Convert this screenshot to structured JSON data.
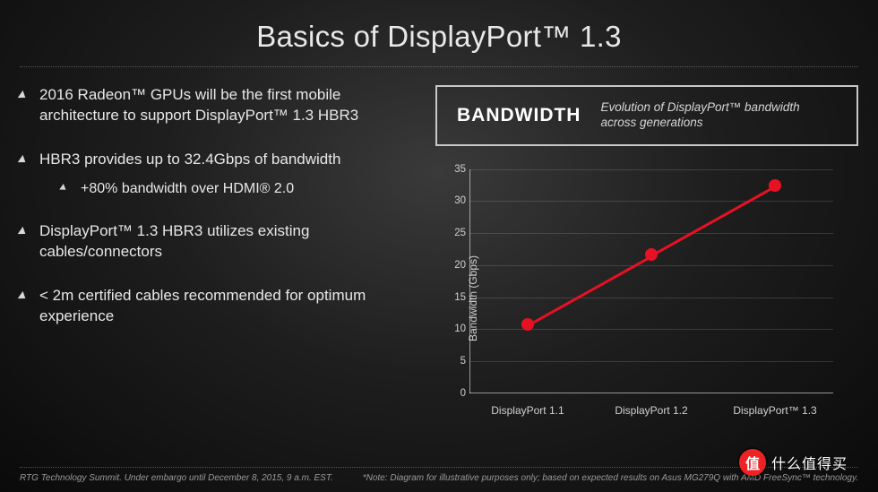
{
  "title": "Basics of DisplayPort™ 1.3",
  "bullets": [
    {
      "text": "2016 Radeon™ GPUs will be the first mobile architecture to support DisplayPort™ 1.3 HBR3"
    },
    {
      "text": "HBR3 provides up to 32.4Gbps of bandwidth",
      "sub": [
        "+80% bandwidth over HDMI® 2.0"
      ]
    },
    {
      "text": "DisplayPort™ 1.3 HBR3 utilizes existing cables/connectors"
    },
    {
      "text": "< 2m certified cables recommended for optimum experience"
    }
  ],
  "box": {
    "title": "BANDWIDTH",
    "subtitle": "Evolution of DisplayPort™ bandwidth across generations"
  },
  "footer": {
    "left": "RTG Technology Summit. Under embargo until December 8, 2015, 9 a.m. EST.",
    "right": "*Note: Diagram for illustrative purposes only; based on expected results on Asus MG279Q with AMD FreeSync™ technology."
  },
  "watermark": {
    "badge": "值",
    "text": "什么值得买"
  },
  "chart_data": {
    "type": "line",
    "title": "BANDWIDTH",
    "subtitle": "Evolution of DisplayPort™ bandwidth across generations",
    "xlabel": "",
    "ylabel": "Bandwidth (Gbps)",
    "ylim": [
      0,
      35
    ],
    "yticks": [
      0,
      5,
      10,
      15,
      20,
      25,
      30,
      35
    ],
    "categories": [
      "DisplayPort 1.1",
      "DisplayPort 1.2",
      "DisplayPort™ 1.3"
    ],
    "values": [
      10.8,
      21.6,
      32.4
    ],
    "color": "#e81123"
  }
}
